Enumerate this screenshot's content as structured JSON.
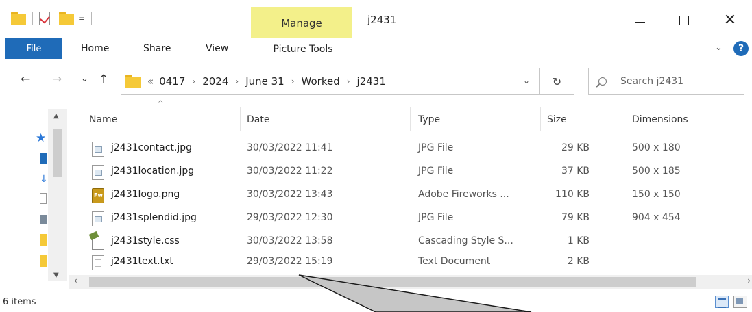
{
  "window": {
    "title": "j2431",
    "context_tab": "Manage",
    "minimize_icon": "minimize-icon",
    "maximize_icon": "maximize-icon",
    "close_glyph": "✕"
  },
  "quick_access": {
    "icons": [
      "folder-icon",
      "properties-check-icon",
      "new-folder-icon",
      "customize-dropdown-icon"
    ],
    "dropdown_glyph": "="
  },
  "ribbon": {
    "file": "File",
    "tabs": [
      "Home",
      "Share",
      "View"
    ],
    "picture_tools": "Picture Tools",
    "expand_glyph": "⌄",
    "help_glyph": "?"
  },
  "navigation": {
    "back_glyph": "←",
    "forward_glyph": "→",
    "recent_glyph": "⌄",
    "up_glyph": "↑"
  },
  "address": {
    "overflow": "«",
    "separator": "›",
    "path": [
      "0417",
      "2024",
      "June 31",
      "Worked",
      "j2431"
    ],
    "dropdown_glyph": "⌄",
    "refresh_glyph": "↻"
  },
  "search": {
    "placeholder": "Search j2431"
  },
  "columns": {
    "name": "Name",
    "date": "Date",
    "type": "Type",
    "size": "Size",
    "dimensions": "Dimensions"
  },
  "files": [
    {
      "name": "j2431contact.jpg",
      "date": "30/03/2022 11:41",
      "type": "JPG File",
      "size": "29 KB",
      "dimensions": "500 x 180",
      "icon": "image-file-icon"
    },
    {
      "name": "j2431location.jpg",
      "date": "30/03/2022 11:22",
      "type": "JPG File",
      "size": "37 KB",
      "dimensions": "500 x 185",
      "icon": "image-file-icon"
    },
    {
      "name": "j2431logo.png",
      "date": "30/03/2022 13:43",
      "type": "Adobe Fireworks ...",
      "size": "110 KB",
      "dimensions": "150 x 150",
      "icon": "fireworks-file-icon"
    },
    {
      "name": "j2431splendid.jpg",
      "date": "29/03/2022 12:30",
      "type": "JPG File",
      "size": "79 KB",
      "dimensions": "904 x 454",
      "icon": "image-file-icon"
    },
    {
      "name": "j2431style.css",
      "date": "30/03/2022 13:58",
      "type": "Cascading Style S...",
      "size": "1 KB",
      "dimensions": "",
      "icon": "css-file-icon"
    },
    {
      "name": "j2431text.txt",
      "date": "29/03/2022 15:19",
      "type": "Text Document",
      "size": "2 KB",
      "dimensions": "",
      "icon": "text-file-icon"
    }
  ],
  "status": {
    "item_count": "6 items"
  },
  "colors": {
    "file_tab": "#1f6bb8",
    "manage_highlight": "#f3f08a",
    "callout_fill": "#c6c6c6"
  }
}
